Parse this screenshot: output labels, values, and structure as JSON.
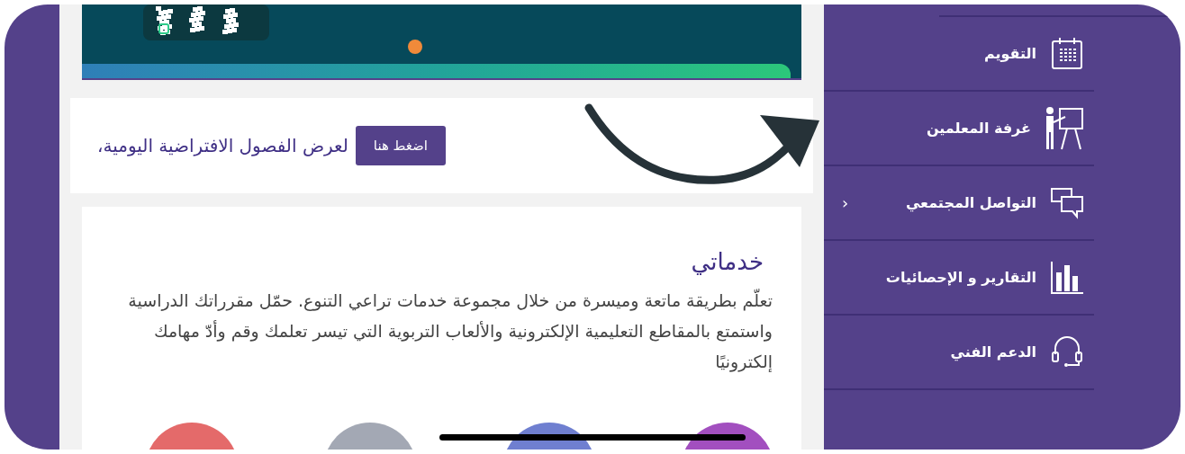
{
  "notice": {
    "text": "لعرض الفصول الافتراضية اليومية،",
    "button": "اضغط هنا"
  },
  "services": {
    "title": "خدماتي",
    "description": "تعلّم بطريقة ماتعة وميسرة من خلال مجموعة خدمات تراعي التنوع. حمّل مقرراتك الدراسية واستمتع بالمقاطع التعليمية الإلكترونية والألعاب التربوية التي تيسر تعلمك وقم وأدّ مهامك إلكترونيًا",
    "tiles": [
      {
        "color": "#a24fbf"
      },
      {
        "color": "#6f7fd0"
      },
      {
        "color": "#a3a8b4"
      },
      {
        "color": "#e46a6a"
      }
    ]
  },
  "sidebar": {
    "items": [
      {
        "kind": "calendar",
        "label": "التقويم"
      },
      {
        "kind": "teacher",
        "label": "غرفة المعلمين"
      },
      {
        "kind": "chat",
        "label": "التواصل المجتمعي",
        "chevron": "‹"
      },
      {
        "kind": "chart",
        "label": "التقارير و الإحصائيات"
      },
      {
        "kind": "support",
        "label": "الدعم الفني"
      }
    ]
  }
}
